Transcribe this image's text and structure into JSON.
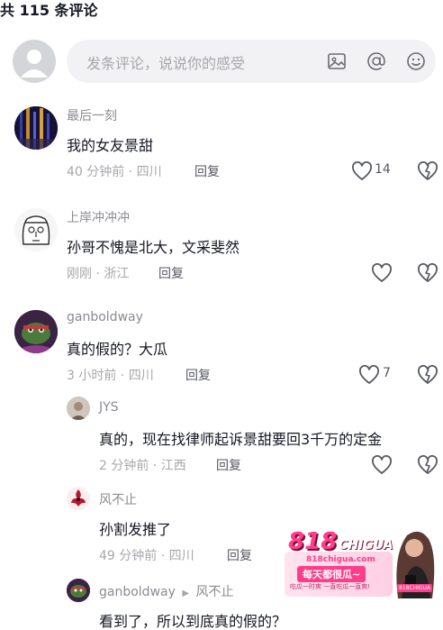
{
  "header": {
    "title": "共 115 条评论"
  },
  "composer": {
    "placeholder": "发条评论，说说你的感受",
    "icons": [
      "image-icon",
      "at-icon",
      "emoji-icon"
    ]
  },
  "comments": [
    {
      "user": "最后一刻",
      "text": "我的女友景甜",
      "meta": "40 分钟前 · 四川",
      "reply": "回复",
      "likes": "14"
    },
    {
      "user": "上岸冲冲冲",
      "text": "孙哥不愧是北大，文采斐然",
      "meta": "刚刚 · 浙江",
      "reply": "回复",
      "likes": ""
    },
    {
      "user": "ganboldway",
      "text": "真的假的？大瓜",
      "meta": "3 小时前 · 四川",
      "reply": "回复",
      "likes": "7"
    }
  ],
  "replies": [
    {
      "user": "JYS",
      "text": "真的，现在找律师起诉景甜要回3千万的定金",
      "meta": "2 分钟前 · 江西",
      "reply": "回复"
    },
    {
      "user": "风不止",
      "text": "孙割发推了",
      "meta": "49 分钟前 · 四川",
      "reply": "回复"
    },
    {
      "user": "ganboldway",
      "reply_to_arrow": "▶",
      "reply_to": "风不止",
      "text": "看到了，所以到底真的假的？"
    }
  ],
  "ad": {
    "brand": "818",
    "brand_suffix": "CHIGUA",
    "site": "818chigua.com",
    "slogan": "每天都很瓜~",
    "subline": "吃瓜一时爽 一直吃瓜一直爽!",
    "badge": "818CHIGUA"
  },
  "colors": {
    "text": "#161823",
    "secondary": "#8a8b91",
    "muted": "#a6a7ab",
    "input_bg": "#f2f2f4",
    "ad_pink": "#ff3d8b"
  }
}
